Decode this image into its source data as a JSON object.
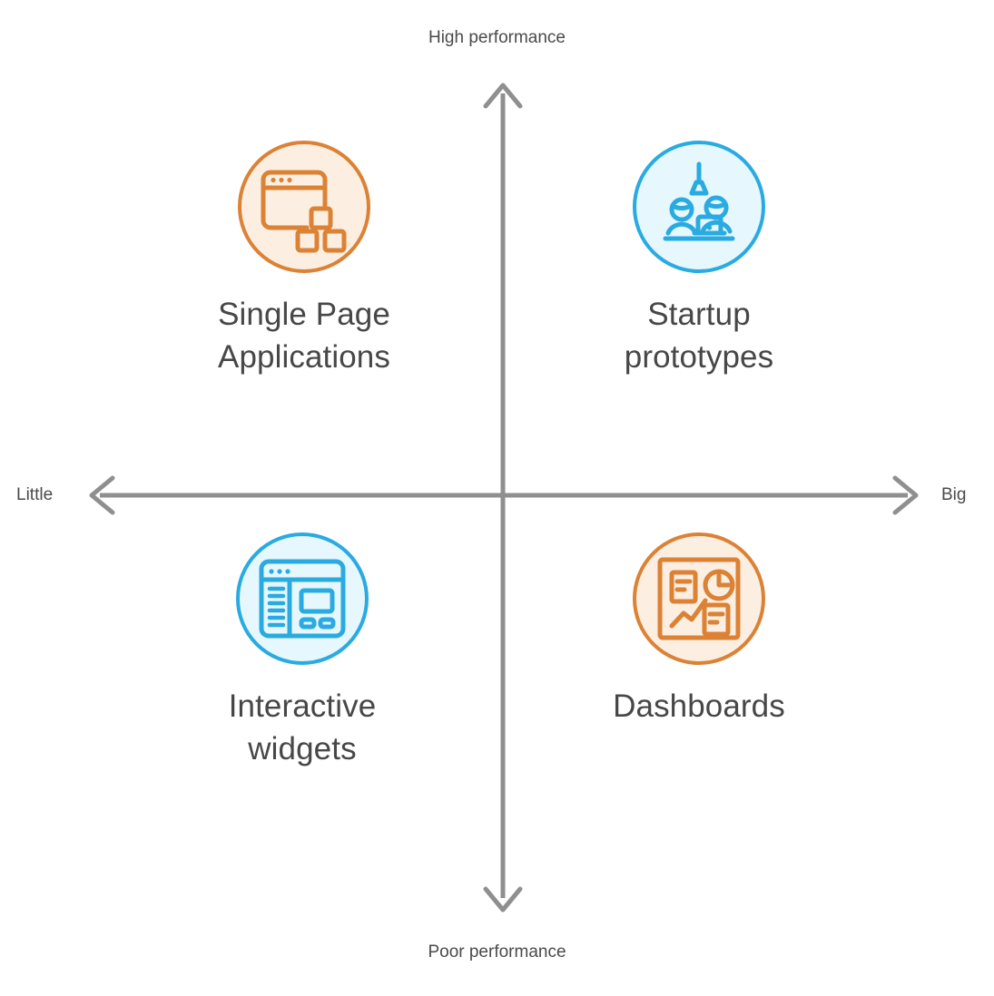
{
  "diagram": {
    "type": "2x2-quadrant-matrix",
    "axes": {
      "vertical": {
        "top_label": "High performance",
        "bottom_label": "Poor performance",
        "color": "#8f8f8f"
      },
      "horizontal": {
        "left_label": "Little",
        "right_label": "Big",
        "color": "#8f8f8f"
      }
    },
    "colors": {
      "orange_stroke": "#DB8235",
      "orange_fill": "#FCEFE2",
      "blue_stroke": "#29ABE2",
      "blue_fill": "#E6F7FD",
      "axis_gray": "#8f8f8f",
      "text_gray": "#474747",
      "background": "#ffffff"
    },
    "quadrants": [
      {
        "position": "top-left",
        "label": "Single Page\nApplications",
        "label_line1": "Single Page",
        "label_line2": "Applications",
        "icon": "browser-window-with-components-icon",
        "color": "orange"
      },
      {
        "position": "top-right",
        "label": "Startup\nprototypes",
        "label_line1": "Startup",
        "label_line2": "prototypes",
        "icon": "team-at-desk-with-lamp-icon",
        "color": "blue"
      },
      {
        "position": "bottom-left",
        "label": "Interactive\nwidgets",
        "label_line1": "Interactive",
        "label_line2": "widgets",
        "icon": "browser-layout-with-sidebar-icon",
        "color": "blue"
      },
      {
        "position": "bottom-right",
        "label": "Dashboards",
        "label_line1": "Dashboards",
        "label_line2": "",
        "icon": "dashboard-charts-panel-icon",
        "color": "orange"
      }
    ]
  }
}
